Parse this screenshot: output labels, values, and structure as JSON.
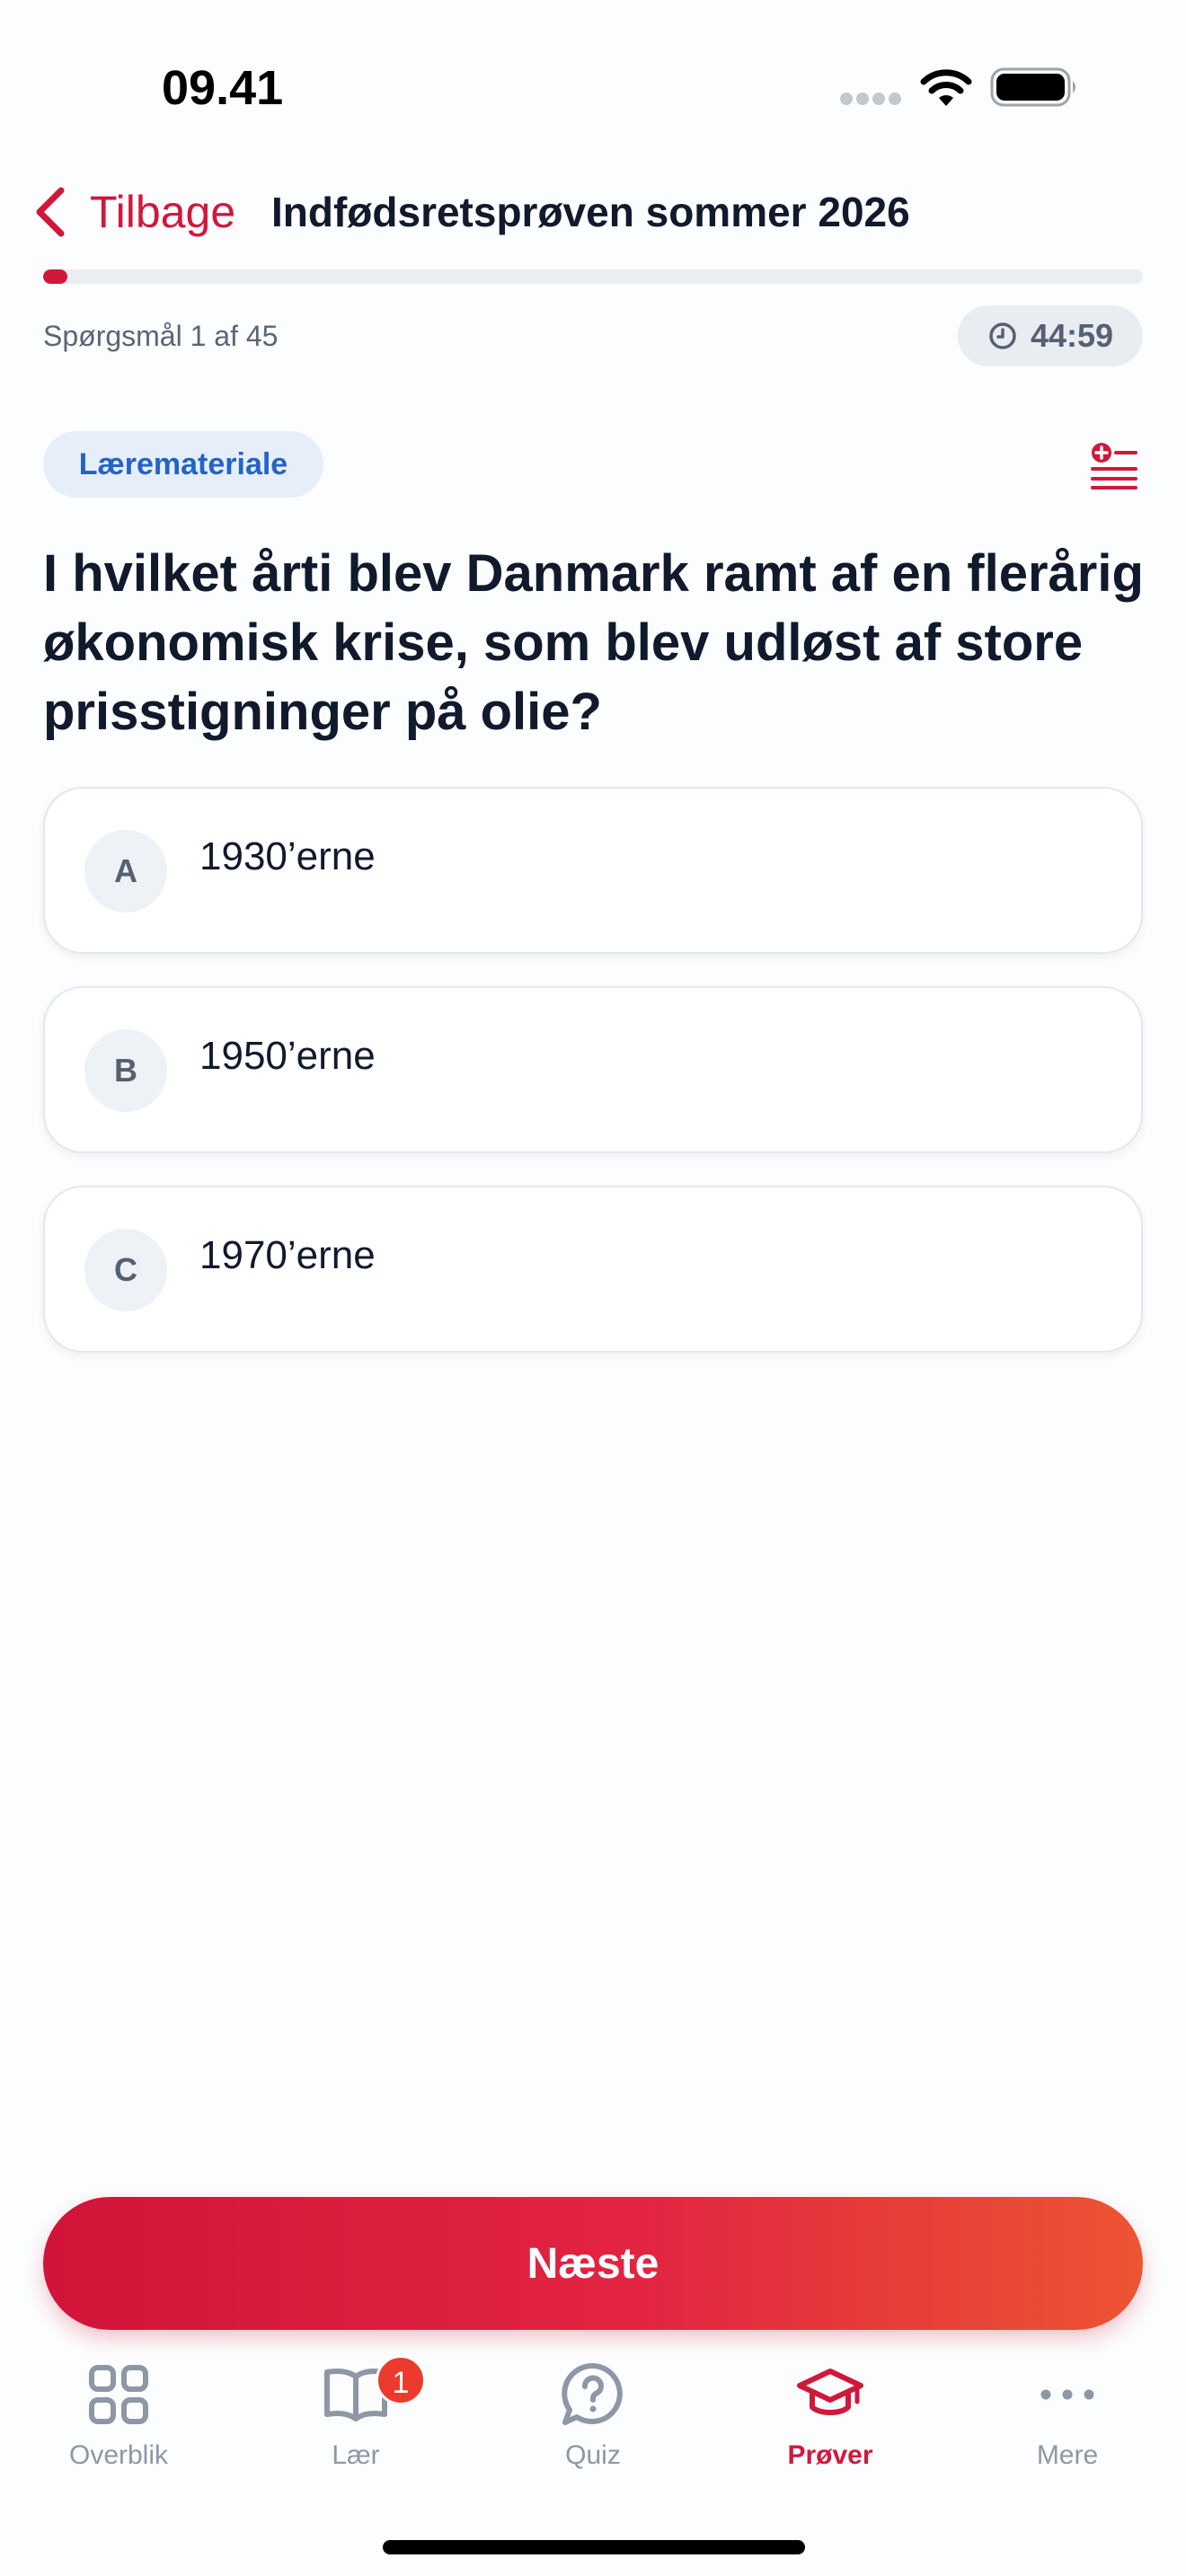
{
  "status_bar": {
    "time": "09.41"
  },
  "header": {
    "back_label": "Tilbage",
    "title": "Indfødsretsprøven sommer 2026"
  },
  "progress": {
    "fraction": 0.0222,
    "counter_text": "Spørgsmål 1 af 45",
    "timer": "44:59"
  },
  "question": {
    "tag": "Læremateriale",
    "text": "I hvilket årti blev Danmark ramt af en flerårig økonomisk krise, som blev udløst af store prisstigninger på olie?",
    "answers": [
      {
        "letter": "A",
        "text": "1930’erne"
      },
      {
        "letter": "B",
        "text": "1950’erne"
      },
      {
        "letter": "C",
        "text": "1970’erne"
      }
    ]
  },
  "actions": {
    "next_label": "Næste"
  },
  "tab_bar": {
    "items": [
      {
        "label": "Overblik",
        "icon": "grid-icon"
      },
      {
        "label": "Lær",
        "icon": "book-icon",
        "badge": "1"
      },
      {
        "label": "Quiz",
        "icon": "question-bubble-icon"
      },
      {
        "label": "Prøver",
        "icon": "graduation-cap-icon",
        "active": true
      },
      {
        "label": "Mere",
        "icon": "more-dots-icon"
      }
    ]
  },
  "colors": {
    "accent": "#d0183b",
    "tag_blue": "#2563c4",
    "inactive_tab": "#8e97a5"
  }
}
